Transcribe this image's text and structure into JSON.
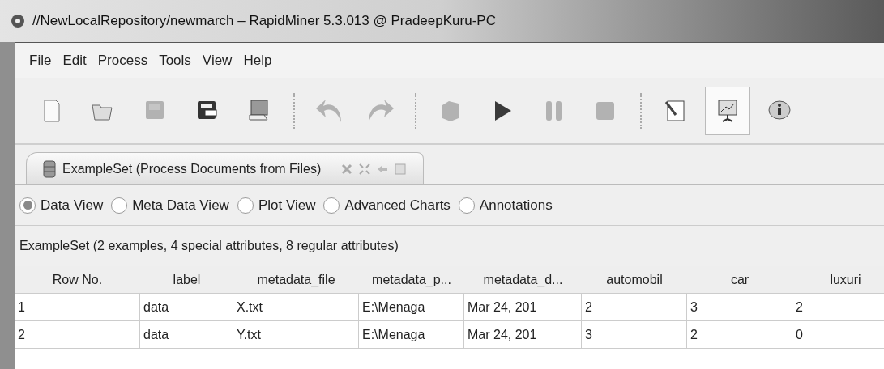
{
  "window": {
    "title": "//NewLocalRepository/newmarch – RapidMiner 5.3.013 @ PradeepKuru-PC"
  },
  "menu": [
    "File",
    "Edit",
    "Process",
    "Tools",
    "View",
    "Help"
  ],
  "toolbar": [
    {
      "kind": "new",
      "disabled": false,
      "selected": false
    },
    {
      "kind": "open",
      "disabled": false,
      "selected": false
    },
    {
      "kind": "save",
      "disabled": true,
      "selected": false
    },
    {
      "kind": "saveas",
      "disabled": false,
      "selected": false
    },
    {
      "kind": "print",
      "disabled": false,
      "selected": false
    },
    {
      "kind": "sep"
    },
    {
      "kind": "undo",
      "disabled": true,
      "selected": false
    },
    {
      "kind": "redo",
      "disabled": true,
      "selected": false
    },
    {
      "kind": "sep"
    },
    {
      "kind": "validate",
      "disabled": true,
      "selected": false
    },
    {
      "kind": "run",
      "disabled": false,
      "selected": false
    },
    {
      "kind": "pause",
      "disabled": true,
      "selected": false
    },
    {
      "kind": "stop",
      "disabled": true,
      "selected": false
    },
    {
      "kind": "sep"
    },
    {
      "kind": "notes",
      "disabled": false,
      "selected": false
    },
    {
      "kind": "results",
      "disabled": false,
      "selected": true
    },
    {
      "kind": "info",
      "disabled": false,
      "selected": false
    }
  ],
  "tab": {
    "label": "ExampleSet (Process Documents from Files)"
  },
  "views": [
    {
      "label": "Data View",
      "selected": true
    },
    {
      "label": "Meta Data View",
      "selected": false
    },
    {
      "label": "Plot View",
      "selected": false
    },
    {
      "label": "Advanced Charts",
      "selected": false
    },
    {
      "label": "Annotations",
      "selected": false
    }
  ],
  "summary": "ExampleSet (2 examples, 4 special attributes, 8 regular attributes)",
  "table": {
    "columns": [
      "Row No.",
      "label",
      "metadata_file",
      "metadata_p...",
      "metadata_d...",
      "automobil",
      "car",
      "luxuri"
    ],
    "rows": [
      [
        "1",
        "data",
        "X.txt",
        "E:\\Menaga",
        "Mar 24, 201",
        "2",
        "3",
        "2"
      ],
      [
        "2",
        "data",
        "Y.txt",
        "E:\\Menaga",
        "Mar 24, 201",
        "3",
        "2",
        "0"
      ]
    ]
  }
}
